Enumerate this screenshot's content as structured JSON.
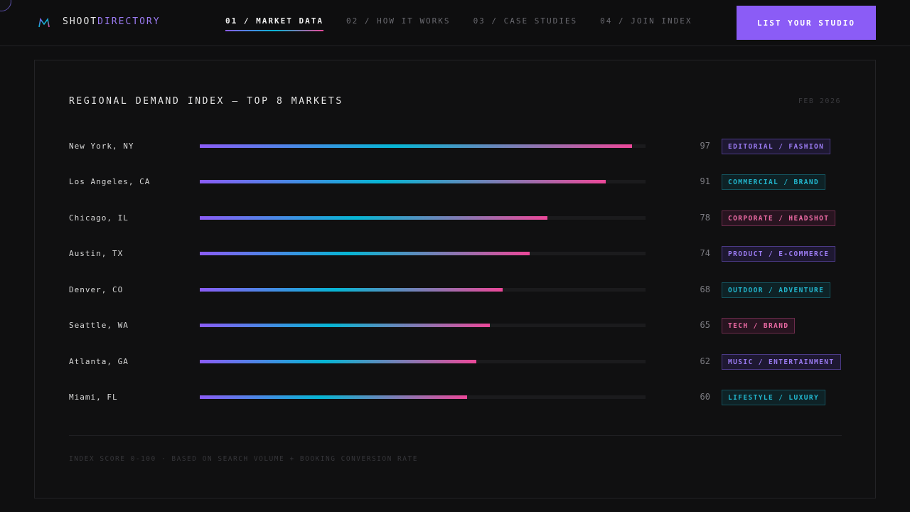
{
  "header": {
    "brand_primary": "SHOOT",
    "brand_accent": "DIRECTORY",
    "nav": [
      {
        "label": "01 / MARKET DATA",
        "active": true
      },
      {
        "label": "02 / HOW IT WORKS",
        "active": false
      },
      {
        "label": "03 / CASE STUDIES",
        "active": false
      },
      {
        "label": "04 / JOIN INDEX",
        "active": false
      }
    ],
    "cta_label": "LIST YOUR STUDIO"
  },
  "colors": {
    "accent_violet": "#8b5cf6",
    "accent_cyan": "#06b6d4",
    "accent_pink": "#ec4899",
    "background": "#0f0f10"
  },
  "chart_data": {
    "type": "bar",
    "orientation": "horizontal",
    "title": "REGIONAL DEMAND INDEX — TOP 8 MARKETS",
    "date": "FEB 2026",
    "xlim": [
      0,
      100
    ],
    "grid": false,
    "categories": [
      "New York, NY",
      "Los Angeles, CA",
      "Chicago, IL",
      "Austin, TX",
      "Denver, CO",
      "Seattle, WA",
      "Atlanta, GA",
      "Miami, FL"
    ],
    "values": [
      97,
      91,
      78,
      74,
      68,
      65,
      62,
      60
    ],
    "tags": [
      {
        "label": "EDITORIAL / FASHION",
        "color": "violet"
      },
      {
        "label": "COMMERCIAL / BRAND",
        "color": "cyan"
      },
      {
        "label": "CORPORATE / HEADSHOT",
        "color": "pink"
      },
      {
        "label": "PRODUCT / E-COMMERCE",
        "color": "violet"
      },
      {
        "label": "OUTDOOR / ADVENTURE",
        "color": "cyan"
      },
      {
        "label": "TECH / BRAND",
        "color": "pink"
      },
      {
        "label": "MUSIC / ENTERTAINMENT",
        "color": "violet"
      },
      {
        "label": "LIFESTYLE / LUXURY",
        "color": "cyan"
      }
    ],
    "footnote": "INDEX SCORE 0-100 · BASED ON SEARCH VOLUME + BOOKING CONVERSION RATE"
  }
}
